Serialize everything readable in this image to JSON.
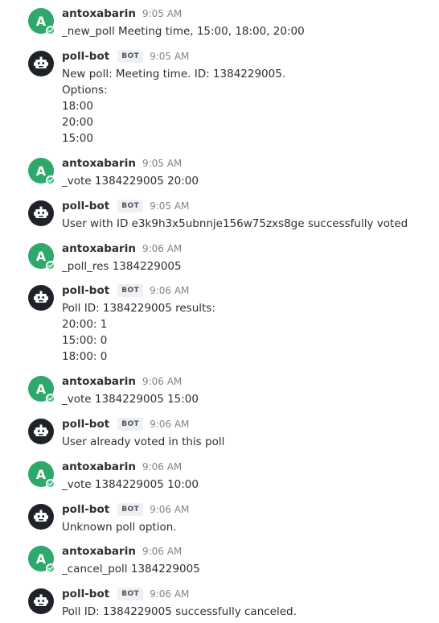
{
  "messages": [
    {
      "author": "antoxabarin",
      "bot": false,
      "time": "9:05 AM",
      "lines": [
        "_new_poll Meeting time, 15:00, 18:00, 20:00"
      ]
    },
    {
      "author": "poll-bot",
      "bot": true,
      "badge": "BOT",
      "time": "9:05 AM",
      "lines": [
        "New poll: Meeting time. ID: 1384229005.",
        "Options:",
        "18:00",
        "20:00",
        "15:00"
      ]
    },
    {
      "author": "antoxabarin",
      "bot": false,
      "time": "9:05 AM",
      "lines": [
        "_vote 1384229005 20:00"
      ]
    },
    {
      "author": "poll-bot",
      "bot": true,
      "badge": "BOT",
      "time": "9:05 AM",
      "lines": [
        "User with ID e3k9h3x5ubnnje156w75zxs8ge successfully voted"
      ]
    },
    {
      "author": "antoxabarin",
      "bot": false,
      "time": "9:06 AM",
      "lines": [
        "_poll_res 1384229005"
      ]
    },
    {
      "author": "poll-bot",
      "bot": true,
      "badge": "BOT",
      "time": "9:06 AM",
      "lines": [
        "Poll ID: 1384229005 results:",
        "20:00: 1",
        "15:00: 0",
        "18:00: 0"
      ]
    },
    {
      "author": "antoxabarin",
      "bot": false,
      "time": "9:06 AM",
      "lines": [
        "_vote 1384229005 15:00"
      ]
    },
    {
      "author": "poll-bot",
      "bot": true,
      "badge": "BOT",
      "time": "9:06 AM",
      "lines": [
        "User already voted in this poll"
      ]
    },
    {
      "author": "antoxabarin",
      "bot": false,
      "time": "9:06 AM",
      "lines": [
        "_vote 1384229005 10:00"
      ]
    },
    {
      "author": "poll-bot",
      "bot": true,
      "badge": "BOT",
      "time": "9:06 AM",
      "lines": [
        "Unknown poll option."
      ]
    },
    {
      "author": "antoxabarin",
      "bot": false,
      "time": "9:06 AM",
      "lines": [
        "_cancel_poll 1384229005"
      ]
    },
    {
      "author": "poll-bot",
      "bot": true,
      "badge": "BOT",
      "time": "9:06 AM",
      "lines": [
        "Poll ID: 1384229005 successfully canceled."
      ]
    }
  ],
  "user_avatar_letter": "A",
  "colors": {
    "user_avatar": "#2fa86c",
    "bot_avatar": "#1f2329",
    "online_status": "#3dbf7e"
  }
}
